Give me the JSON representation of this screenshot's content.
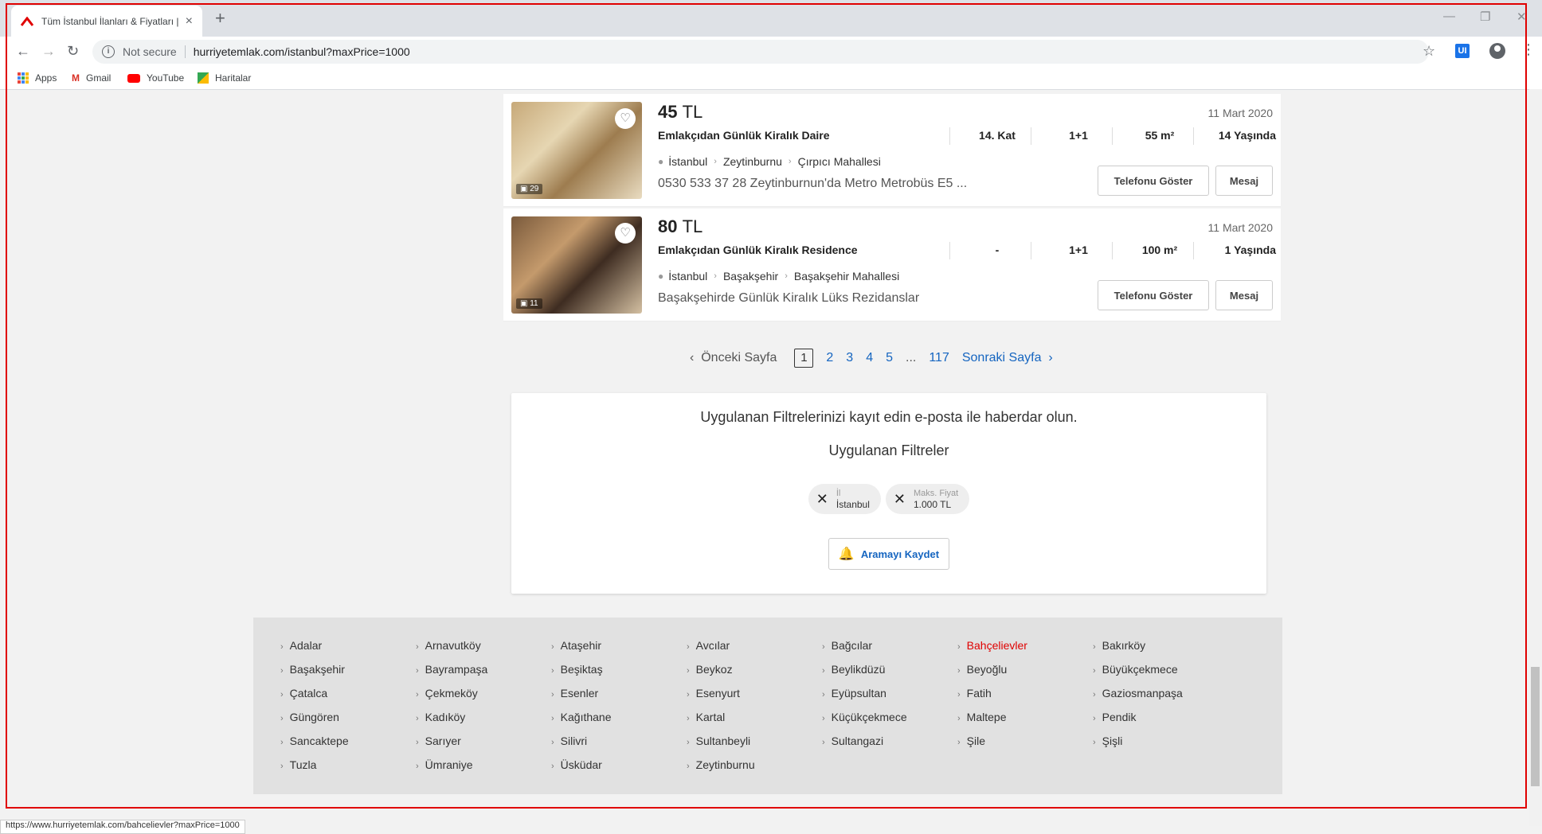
{
  "browser": {
    "tab_title": "Tüm İstanbul İlanları & Fiyatları |",
    "new_tab": "+",
    "not_secure": "Not secure",
    "url": "hurriyetemlak.com/istanbul?maxPrice=1000",
    "ext_label": "UI",
    "bookmarks": [
      "Apps",
      "Gmail",
      "YouTube",
      "Haritalar"
    ],
    "status_url": "https://www.hurriyetemlak.com/bahcelievler?maxPrice=1000"
  },
  "listings": [
    {
      "price": "45",
      "currency": "TL",
      "date": "11 Mart 2020",
      "title": "Emlakçıdan Günlük Kiralık Daire",
      "floor": "14. Kat",
      "rooms": "1+1",
      "area": "55 m²",
      "age": "14 Yaşında",
      "city": "İstanbul",
      "district": "Zeytinburnu",
      "neighborhood": "Çırpıcı Mahallesi",
      "description": "0530 533 37 28 Zeytinburnun'da Metro Metrobüs E5 ...",
      "photo_count": "29",
      "phone_label": "Telefonu Göster",
      "message_label": "Mesaj"
    },
    {
      "price": "80",
      "currency": "TL",
      "date": "11 Mart 2020",
      "title": "Emlakçıdan Günlük Kiralık Residence",
      "floor": "-",
      "rooms": "1+1",
      "area": "100 m²",
      "age": "1 Yaşında",
      "city": "İstanbul",
      "district": "Başakşehir",
      "neighborhood": "Başakşehir Mahallesi",
      "description": "Başakşehirde Günlük Kiralık Lüks Rezidanslar",
      "photo_count": "11",
      "phone_label": "Telefonu Göster",
      "message_label": "Mesaj"
    }
  ],
  "pagination": {
    "prev": "Önceki Sayfa",
    "current": "1",
    "pages": [
      "2",
      "3",
      "4",
      "5"
    ],
    "dots": "...",
    "last": "117",
    "next": "Sonraki Sayfa"
  },
  "filters": {
    "title": "Uygulanan Filtrelerinizi kayıt edin e-posta ile haberdar olun.",
    "subtitle": "Uygulanan Filtreler",
    "chips": [
      {
        "label": "İl",
        "value": "İstanbul"
      },
      {
        "label": "Maks. Fiyat",
        "value": "1.000 TL"
      }
    ],
    "save_label": "Aramayı Kaydet"
  },
  "districts": {
    "active": "Bahçelievler",
    "columns": [
      [
        "Adalar",
        "Başakşehir",
        "Çatalca",
        "Güngören",
        "Sancaktepe",
        "Tuzla"
      ],
      [
        "Arnavutköy",
        "Bayrampaşa",
        "Çekmeköy",
        "Kadıköy",
        "Sarıyer",
        "Ümraniye"
      ],
      [
        "Ataşehir",
        "Beşiktaş",
        "Esenler",
        "Kağıthane",
        "Silivri",
        "Üsküdar"
      ],
      [
        "Avcılar",
        "Beykoz",
        "Esenyurt",
        "Kartal",
        "Sultanbeyli",
        "Zeytinburnu"
      ],
      [
        "Bağcılar",
        "Beylikdüzü",
        "Eyüpsultan",
        "Küçükçekmece",
        "Sultangazi"
      ],
      [
        "Bahçelievler",
        "Beyoğlu",
        "Fatih",
        "Maltepe",
        "Şile"
      ],
      [
        "Bakırköy",
        "Büyükçekmece",
        "Gaziosmanpaşa",
        "Pendik",
        "Şişli"
      ]
    ]
  },
  "colors": {
    "brand_red": "#e00000",
    "link_blue": "#1565c0"
  }
}
